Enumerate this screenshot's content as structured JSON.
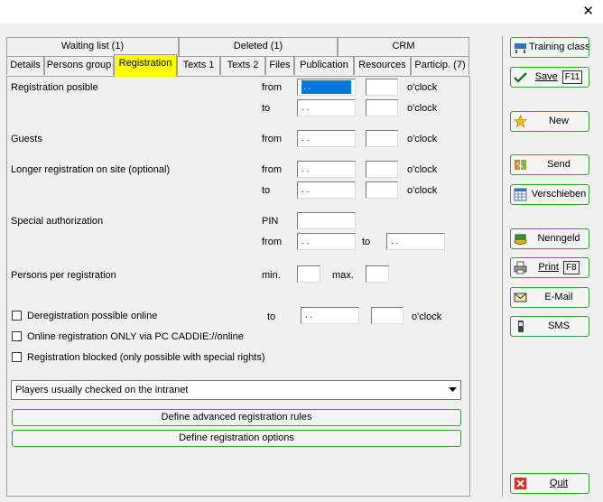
{
  "window": {
    "close_glyph": "✕"
  },
  "tabs_top": [
    {
      "label": "Waiting list (1)"
    },
    {
      "label": "Deleted (1)"
    },
    {
      "label": "CRM"
    }
  ],
  "tabs_bottom": [
    {
      "label": "Details"
    },
    {
      "label": "Persons group"
    },
    {
      "label": "Registration",
      "active": true
    },
    {
      "label": "Texts 1"
    },
    {
      "label": "Texts 2"
    },
    {
      "label": "Files"
    },
    {
      "label": "Publication"
    },
    {
      "label": "Resources"
    },
    {
      "label": "Particip. (7)"
    }
  ],
  "form": {
    "reg_possible": {
      "label": "Registration posible",
      "from": "from",
      "to": "to",
      "oclock": "o'clock",
      "from_date": ". .",
      "to_date": ". ."
    },
    "guests": {
      "label": "Guests",
      "from": "from",
      "date": ". .",
      "oclock": "o'clock"
    },
    "longer": {
      "label": "Longer registration on site (optional)",
      "from": "from",
      "to": "to",
      "oclock": "o'clock",
      "from_date": ". .",
      "to_date": ". ."
    },
    "special": {
      "label": "Special authorization",
      "pin": "PIN",
      "from": "from",
      "to": "to",
      "from_date": ". .",
      "to_date": ". ."
    },
    "persons": {
      "label": "Persons per registration",
      "min": "min.",
      "max": "max."
    },
    "dereg": {
      "label": "Deregistration possible online",
      "to": "to",
      "date": ". .",
      "oclock": "o'clock"
    },
    "online_only": {
      "label": "Online registration ONLY via PC CADDIE://online"
    },
    "blocked": {
      "label": "Registration blocked (only possible with special rights)"
    },
    "select_value": "Players usually checked on the intranet",
    "btn_rules": "Define advanced registration rules",
    "btn_options": "Define registration options"
  },
  "sidebar": {
    "training_class": "Training class",
    "save": "Save",
    "save_key": "F11",
    "new": "New",
    "send": "Send",
    "verschieben": "Verschieben",
    "nenngeld": "Nenngeld",
    "print": "Print",
    "print_key": "F8",
    "email": "E-Mail",
    "sms": "SMS",
    "quit": "Quit"
  },
  "colors": {
    "active_tab": "#ffff00",
    "button_border": "#3f9a3f",
    "focus": "#0078d7"
  },
  "icons": [
    "close-icon",
    "training-class-icon",
    "save-checkmark-icon",
    "new-star-icon",
    "send-icon",
    "calendar-icon",
    "money-icon",
    "printer-icon",
    "mail-icon",
    "phone-icon",
    "quit-icon",
    "dropdown-arrow-icon"
  ]
}
